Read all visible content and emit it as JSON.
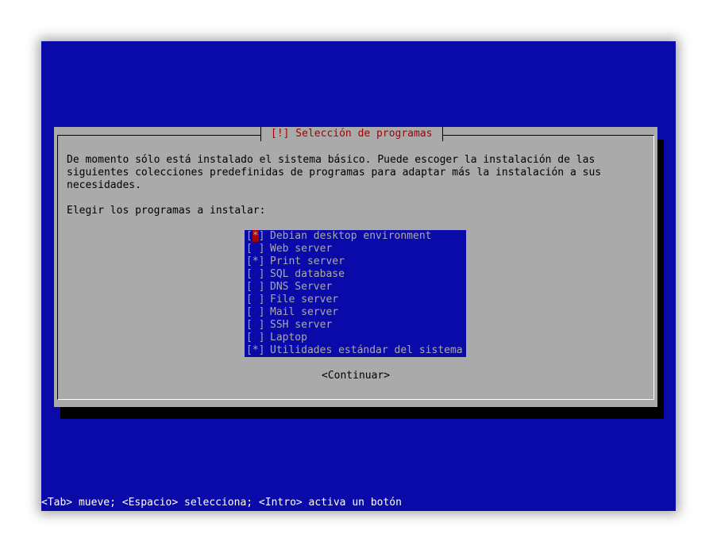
{
  "dialog": {
    "title": "[!] Selección de programas",
    "description": [
      "De momento sólo está instalado el sistema básico. Puede escoger la instalación de las",
      "siguientes colecciones predefinidas de programas para adaptar más la instalación a sus",
      "necesidades."
    ],
    "prompt": "Elegir los programas a instalar:",
    "items": [
      {
        "label": "Debian desktop environment",
        "checked": true,
        "mark": "*"
      },
      {
        "label": "Web server",
        "checked": false,
        "mark": " "
      },
      {
        "label": "Print server",
        "checked": true,
        "mark": "*"
      },
      {
        "label": "SQL database",
        "checked": false,
        "mark": " "
      },
      {
        "label": "DNS Server",
        "checked": false,
        "mark": " "
      },
      {
        "label": "File server",
        "checked": false,
        "mark": " "
      },
      {
        "label": "Mail server",
        "checked": false,
        "mark": " "
      },
      {
        "label": "SSH server",
        "checked": false,
        "mark": " "
      },
      {
        "label": "Laptop",
        "checked": false,
        "mark": " "
      },
      {
        "label": "Utilidades estándar del sistema",
        "checked": true,
        "mark": "*"
      }
    ],
    "continue_label": "<Continuar>"
  },
  "statusbar": {
    "text": "<Tab> mueve; <Espacio> selecciona; <Intro> activa un botón"
  },
  "colors": {
    "background": "#0a0aa8",
    "dialog": "#aaaaaa",
    "title": "#a80000",
    "cursor": "#a80000"
  }
}
